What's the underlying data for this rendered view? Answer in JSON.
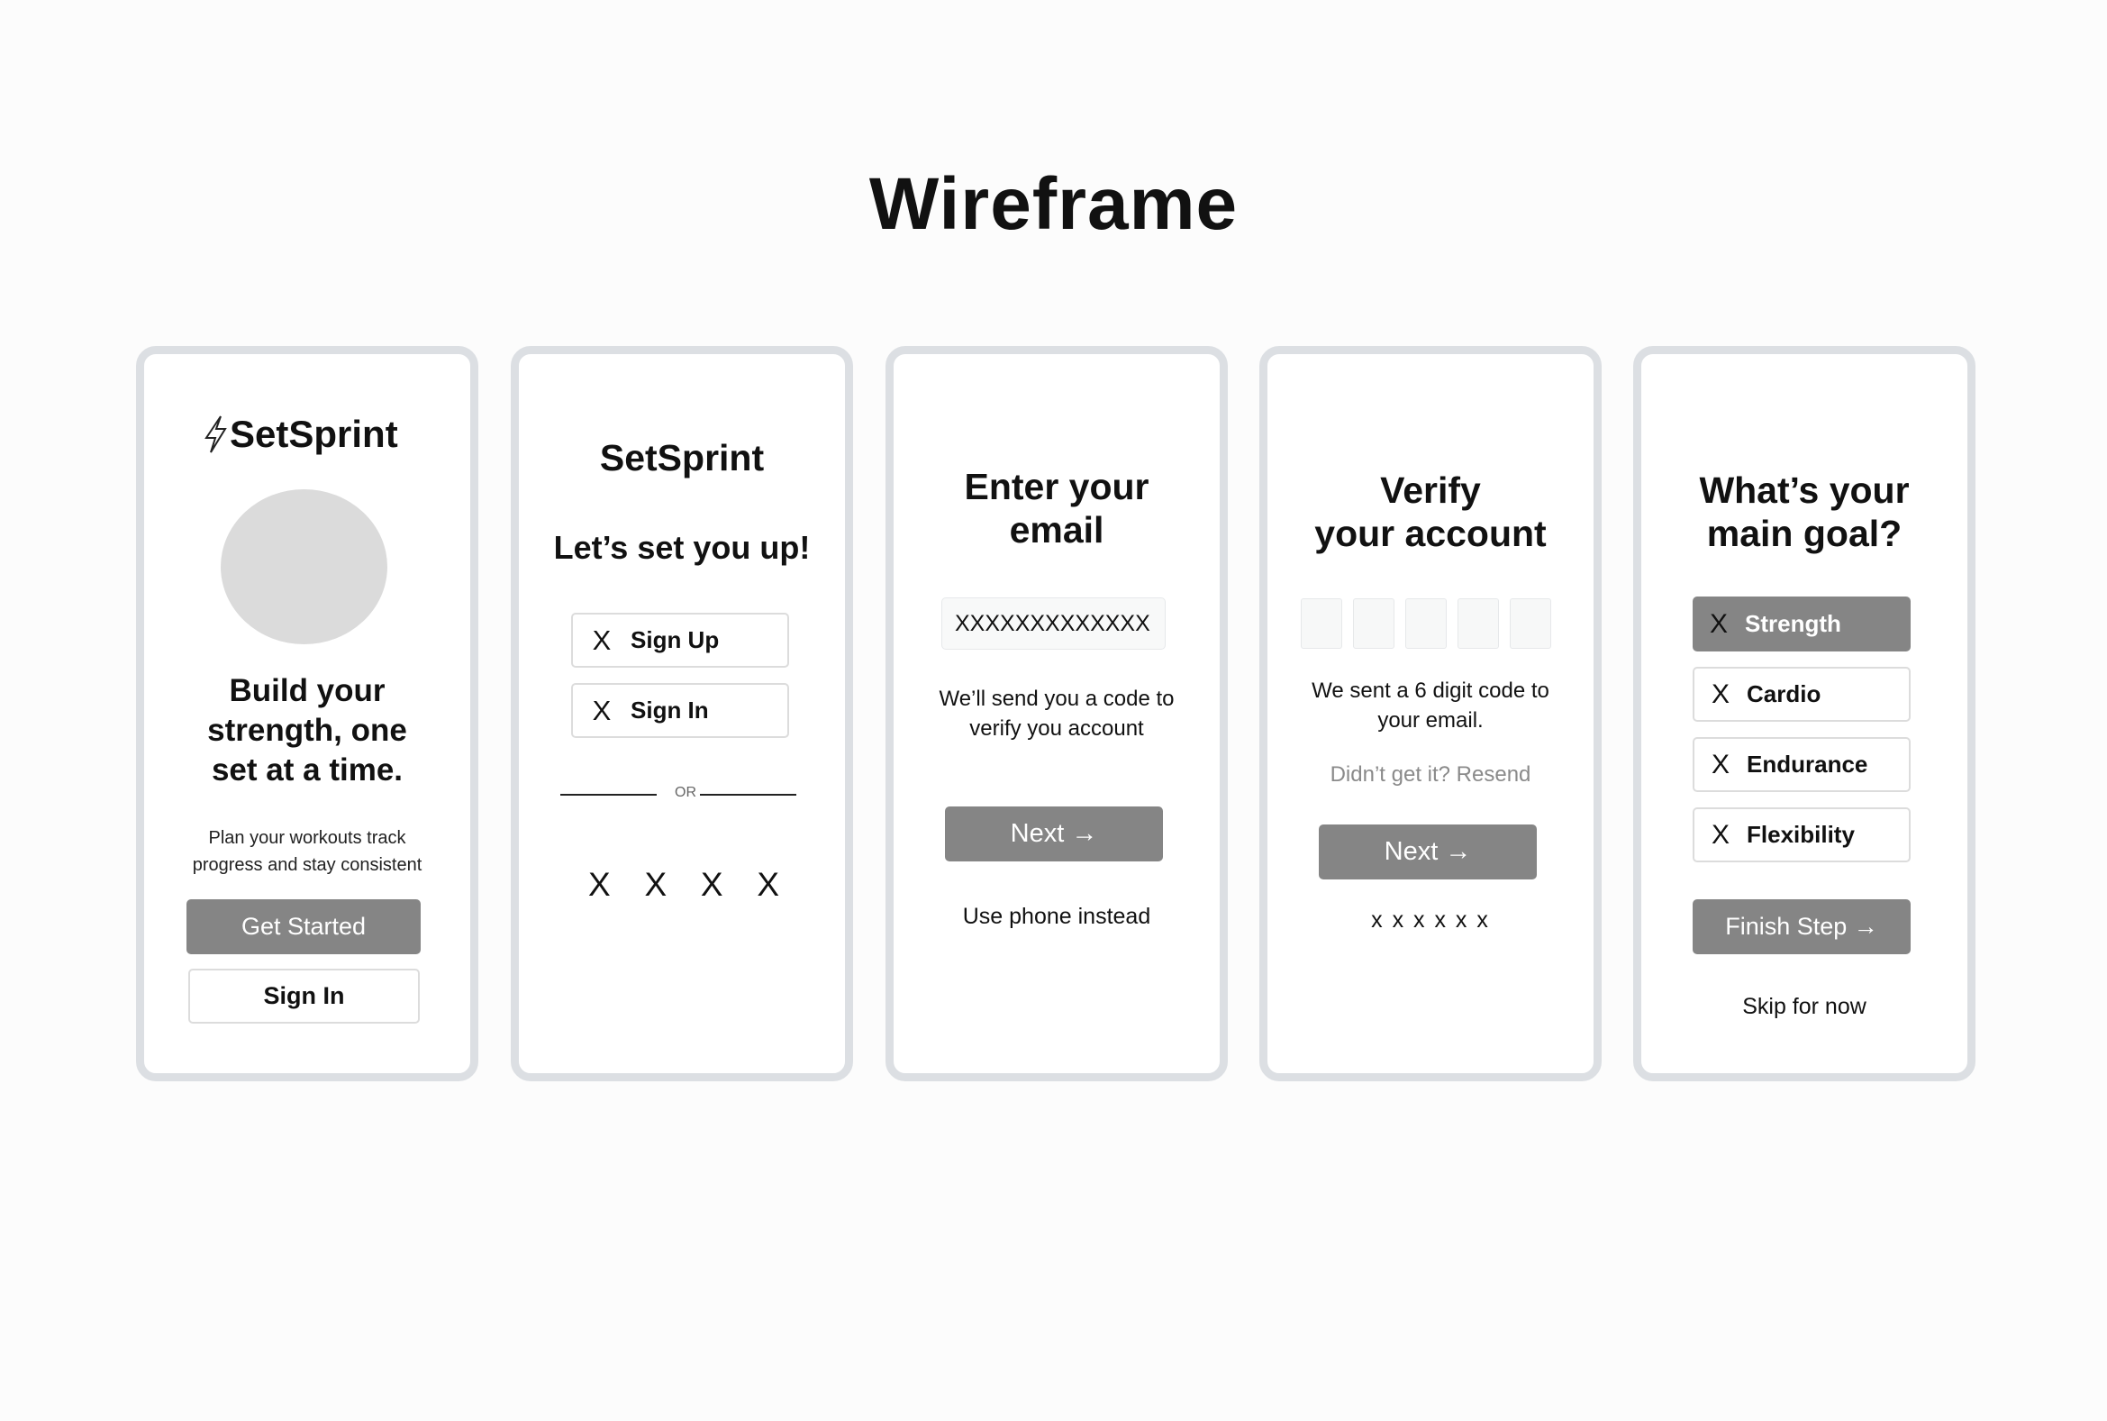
{
  "page": {
    "title": "Wireframe"
  },
  "colors": {
    "frame_border": "#dcdfe3",
    "button_fill": "#858585",
    "placeholder_circle": "#dbdbdb"
  },
  "screen1": {
    "logo": "SetSprint",
    "logo_icon": "lightning-bolt-icon",
    "headline_lines": [
      "Build your",
      "strength, one",
      "set at a time."
    ],
    "description_lines": [
      "Plan your workouts track",
      "progress and stay consistent"
    ],
    "primary_button": "Get Started",
    "secondary_button": "Sign In"
  },
  "screen2": {
    "title": "SetSprint",
    "subtitle": "Let’s set you up!",
    "buttons": [
      {
        "icon": "X",
        "label": "Sign Up"
      },
      {
        "icon": "X",
        "label": "Sign In"
      }
    ],
    "divider_text": "OR",
    "social_placeholders": [
      "X",
      "X",
      "X",
      "X"
    ]
  },
  "screen3": {
    "title_lines": [
      "Enter your",
      "email"
    ],
    "email_value": "XXXXXXXXXXXXX",
    "info_lines": [
      "We’ll send you a code to",
      "verify you account"
    ],
    "next_button": "Next →",
    "alt_link": "Use phone instead"
  },
  "screen4": {
    "title_lines": [
      "Verify",
      "your account"
    ],
    "info_lines": [
      "We sent a 6 digit code to",
      "your email."
    ],
    "resend_text": "Didn’t get it? Resend",
    "next_button": "Next →",
    "code_placeholder": "x x x x x x"
  },
  "screen5": {
    "title_lines": [
      "What’s your",
      "main goal?"
    ],
    "options": [
      {
        "icon": "X",
        "label": "Strength",
        "selected": true
      },
      {
        "icon": "X",
        "label": "Cardio",
        "selected": false
      },
      {
        "icon": "X",
        "label": "Endurance",
        "selected": false
      },
      {
        "icon": "X",
        "label": "Flexibility",
        "selected": false
      }
    ],
    "finish_button": "Finish Step →",
    "skip_link": "Skip for now"
  }
}
